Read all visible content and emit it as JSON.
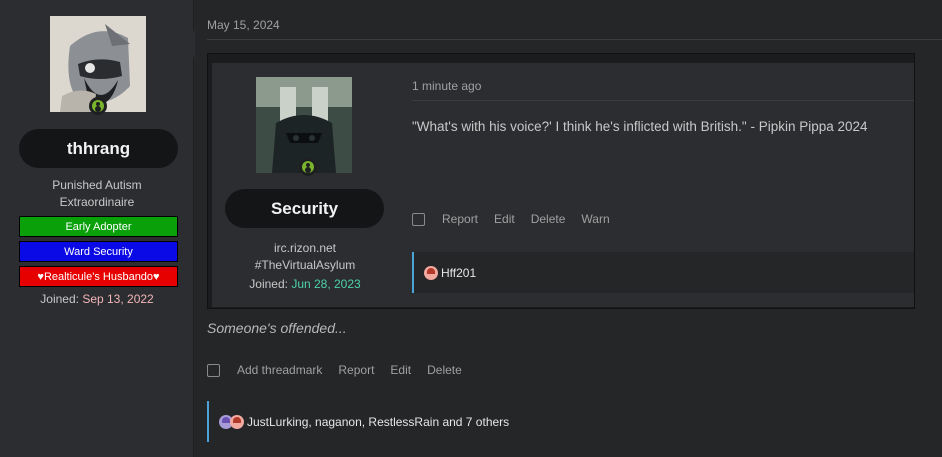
{
  "post": {
    "date": "May 15, 2024",
    "body": "Someone's offended...",
    "actions": [
      "Add threadmark",
      "Report",
      "Edit",
      "Delete"
    ],
    "reactions": "JustLurking, naganon, RestlessRain and 7 others"
  },
  "author": {
    "name": "thhrang",
    "title_line1": "Punished Autism",
    "title_line2": "Extraordinaire",
    "banners": [
      {
        "label": "Early Adopter",
        "color": "#0aa00a"
      },
      {
        "label": "Ward Security",
        "color": "#0a0ae6"
      },
      {
        "label": "♥Realticule's Husbando♥",
        "color": "#e60000"
      }
    ],
    "joined_label": "Joined:",
    "joined_date": "Sep 13, 2022"
  },
  "quote": {
    "name": "Security",
    "title_line1": "irc.rizon.net",
    "title_line2": "#TheVirtualAsylum",
    "joined_label": "Joined:",
    "joined_date": "Jun 28, 2023",
    "time": "1 minute ago",
    "text": "\"What's with his voice?' I think he's inflicted with British.\" - Pipkin Pippa 2024",
    "actions": [
      "Report",
      "Edit",
      "Delete",
      "Warn"
    ],
    "reactions": "Hff201"
  },
  "colors": {
    "accent_border": "#4ba3d8",
    "online": "#7ab52b",
    "joined_quote": "#4fd1a6",
    "joined_author": "#f2b6b6"
  },
  "icons": [
    "online-status-icon",
    "checkbox-icon",
    "reaction-icon"
  ]
}
